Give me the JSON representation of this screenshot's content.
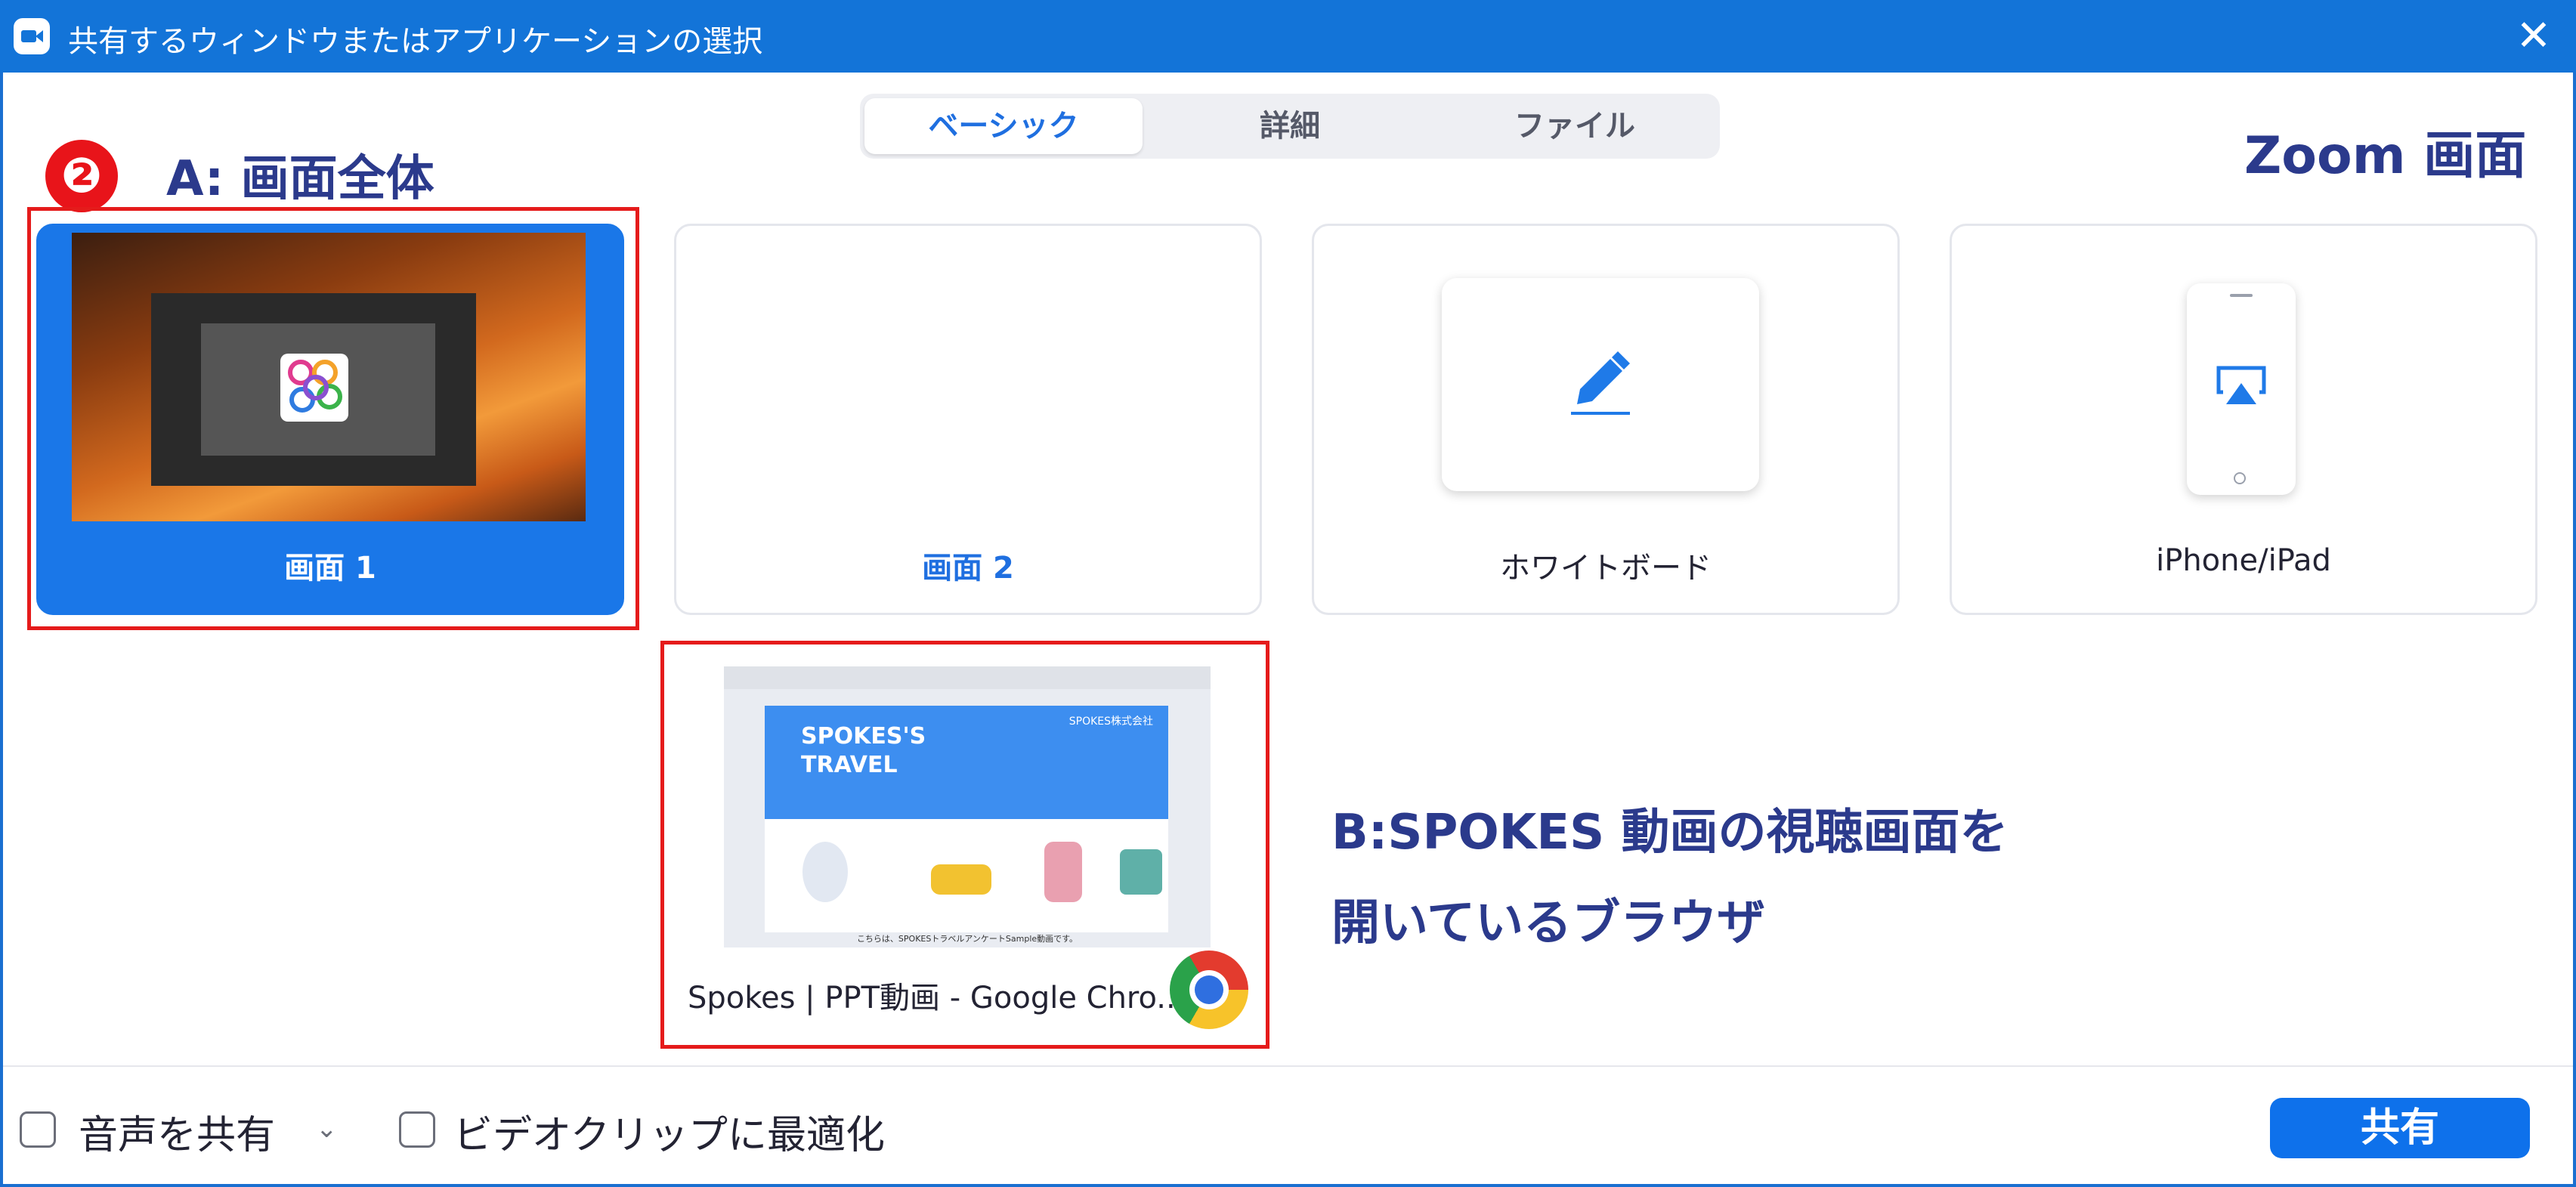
{
  "window": {
    "title": "共有するウィンドウまたはアプリケーションの選択",
    "close_glyph": "✕"
  },
  "tabs": [
    {
      "label": "ベーシック",
      "active": true
    },
    {
      "label": "詳細",
      "active": false
    },
    {
      "label": "ファイル",
      "active": false
    }
  ],
  "annotations": {
    "step_badge": "❷",
    "a_label": "A: 画面全体",
    "zoom_label": "Zoom 画面",
    "b_line1": "B:SPOKES 動画の視聴画面を",
    "b_line2": "開いているブラウザ"
  },
  "cards": {
    "screen1": {
      "label": "画面 1",
      "selected": true
    },
    "screen2": {
      "label": "画面 2"
    },
    "whiteboard": {
      "label": "ホワイトボード",
      "icon": "pencil-icon"
    },
    "iphone": {
      "label": "iPhone/iPad",
      "icon": "airplay-icon"
    },
    "chrome": {
      "label": "Spokes | PPT動画 - Google Chro...",
      "icon": "chrome-icon",
      "thumb": {
        "title_line1": "SPOKES'S",
        "title_line2": "TRAVEL",
        "company": "SPOKES株式会社",
        "caption": "こちらは、SPOKESトラベルアンケートSample動画です。"
      }
    }
  },
  "footer": {
    "audio_label": "音声を共有",
    "audio_checked": false,
    "video_label": "ビデオクリップに最適化",
    "video_checked": false,
    "share_button": "共有"
  },
  "colors": {
    "titlebar": "#1374d8",
    "accent": "#0e71eb",
    "selected_card": "#1a77e8",
    "annotation_text": "#2b3a8c",
    "annotation_box": "#e51b1b"
  }
}
